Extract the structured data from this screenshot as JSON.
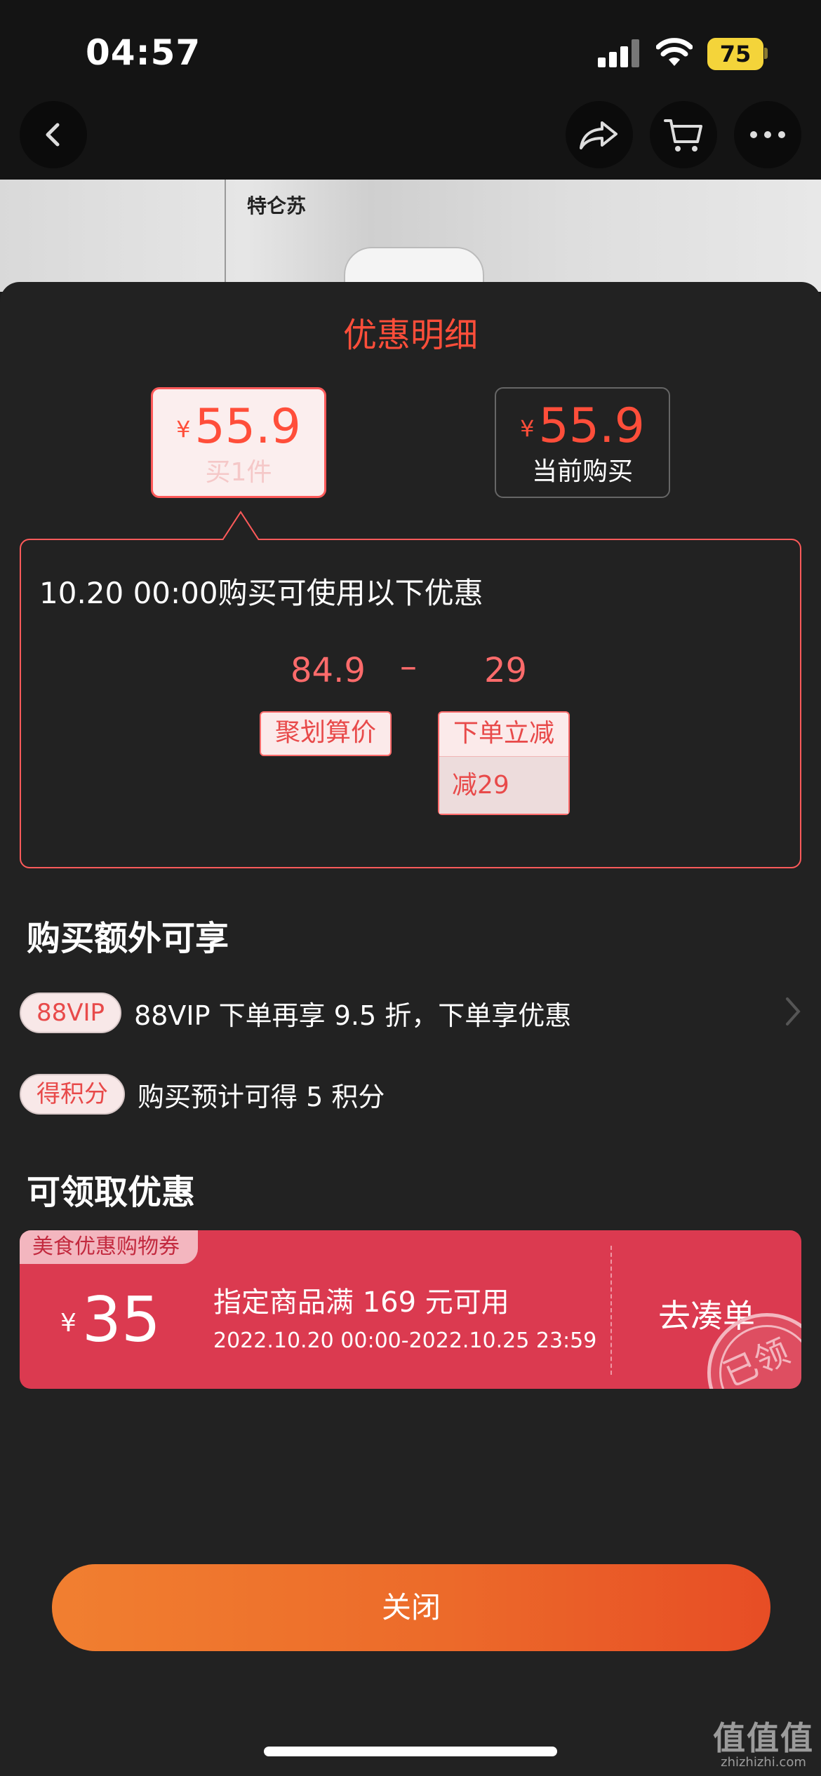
{
  "status_bar": {
    "time": "04:57",
    "battery": "75"
  },
  "product": {
    "brand": "特仑苏"
  },
  "sheet": {
    "title": "优惠明细",
    "price_cards": [
      {
        "currency": "¥",
        "price": "55.9",
        "label": "买1件"
      },
      {
        "currency": "¥",
        "price": "55.9",
        "label": "当前购买"
      }
    ],
    "detail": {
      "headline": "10.20 00:00购买可使用以下优惠",
      "base_price": "84.9",
      "operator": "–",
      "discount": "29",
      "base_tag": "聚划算价",
      "discount_tag": "下单立减",
      "discount_sub": "减29"
    },
    "extra": {
      "title": "购买额外可享",
      "items": [
        {
          "pill": "88VIP",
          "text": "88VIP 下单再享 9.5 折，下单享优惠"
        },
        {
          "pill": "得积分",
          "text": "购买预计可得 5 积分"
        }
      ]
    },
    "coupons": {
      "title": "可领取优惠",
      "coupon": {
        "tag": "美食优惠购物券",
        "currency": "¥",
        "amount": "35",
        "condition": "指定商品满 169 元可用",
        "date_range": "2022.10.20 00:00-2022.10.25 23:59",
        "action": "去凑单",
        "status": "已领"
      }
    },
    "close_label": "关闭"
  },
  "watermark": {
    "main": "值值值",
    "sub": "zhizhizhi.com"
  },
  "colors": {
    "accent_red": "#ff4e3a",
    "coupon_red": "#db3a50",
    "close_orange": "#ec6a2a"
  }
}
